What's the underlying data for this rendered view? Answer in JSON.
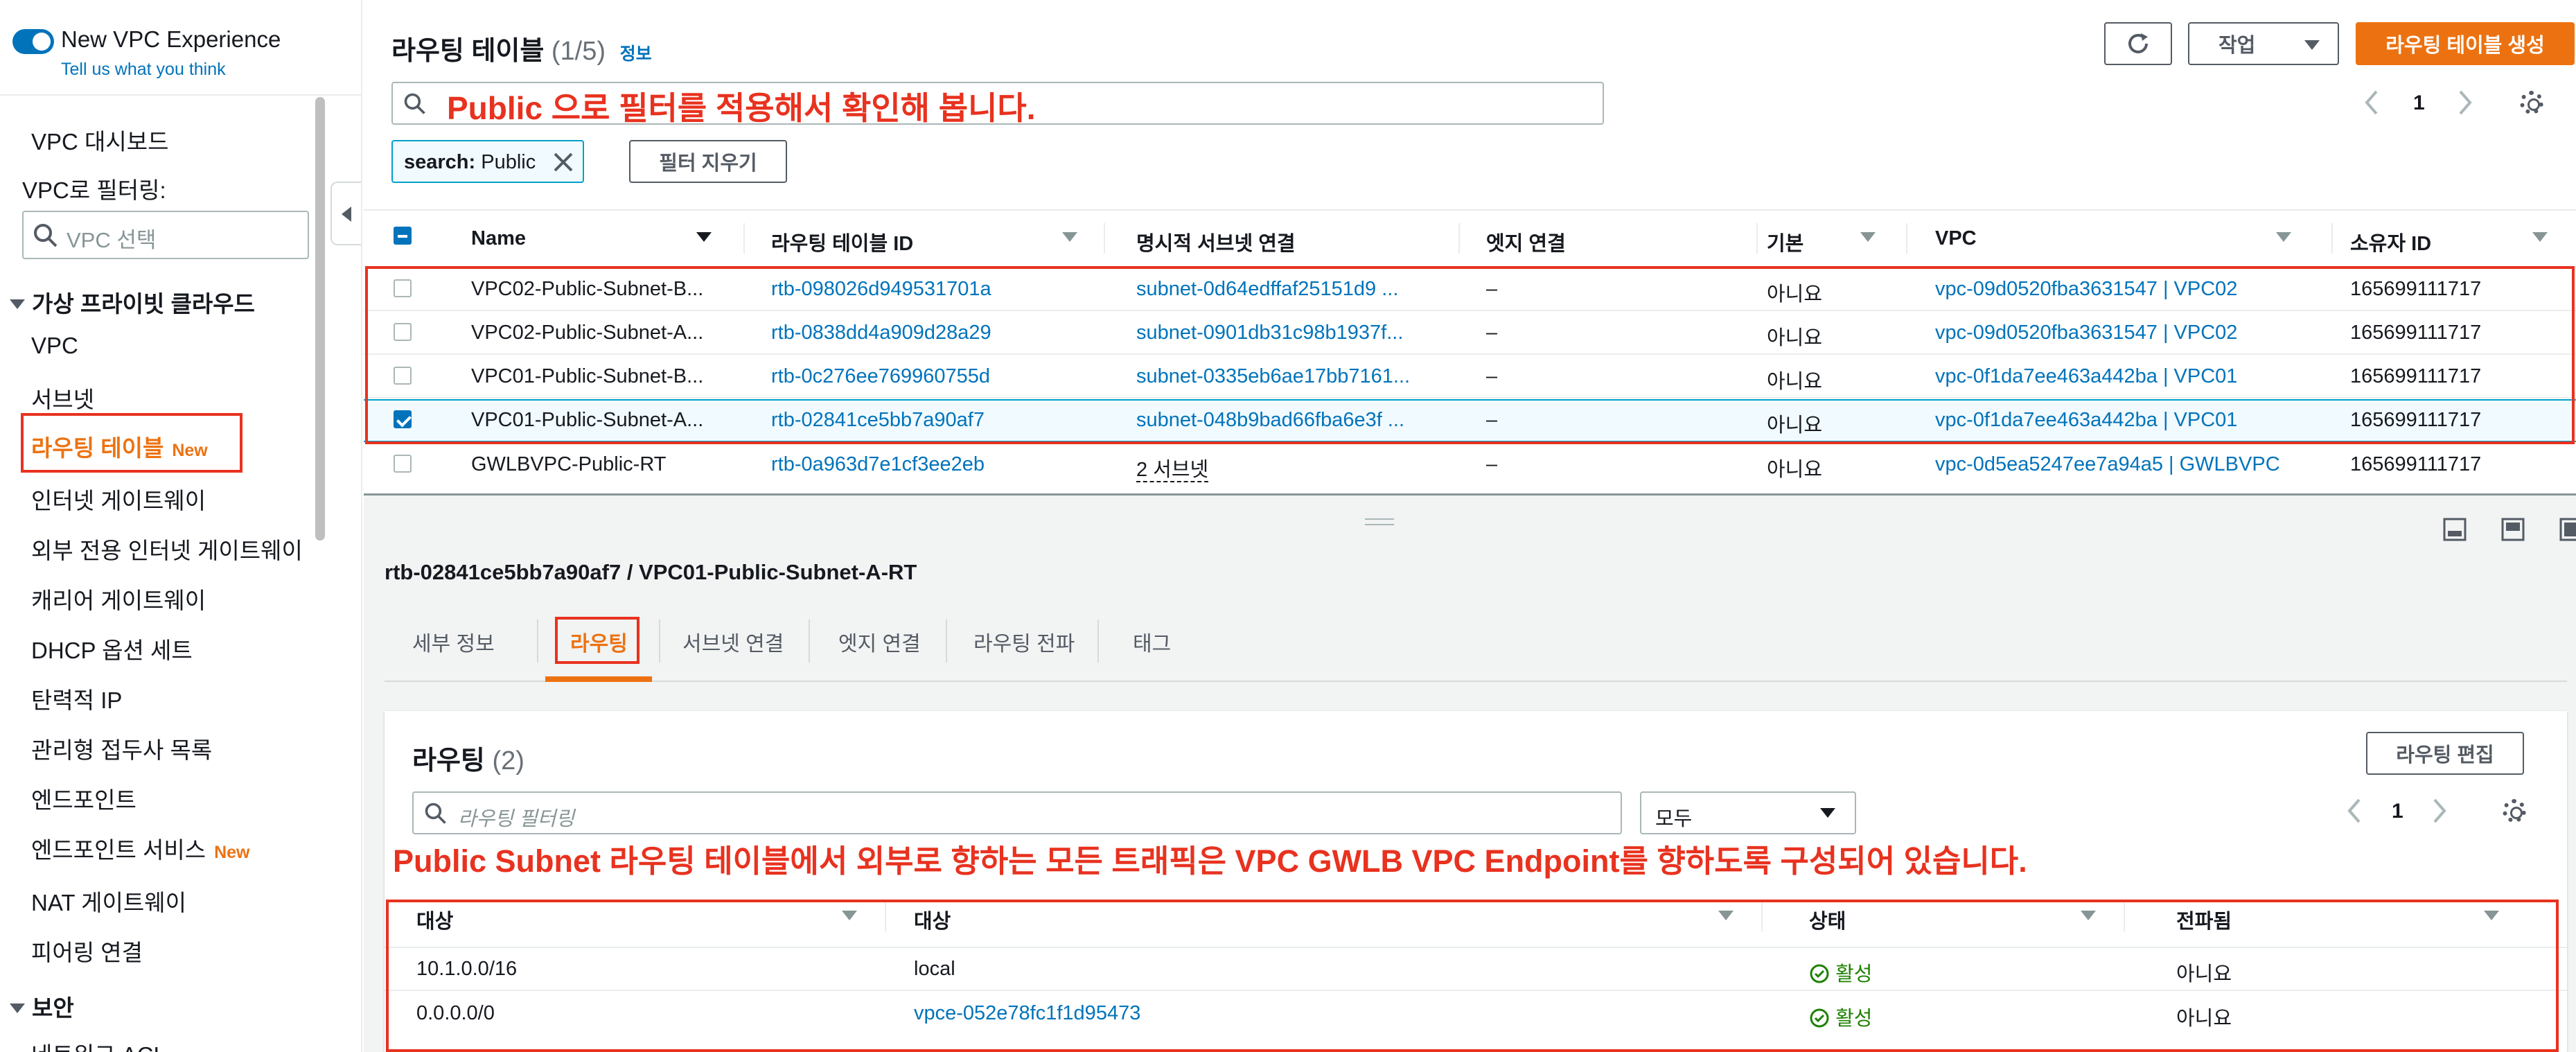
{
  "sidebar": {
    "experience_label": "New VPC Experience",
    "feedback_link": "Tell us what you think",
    "dashboard": "VPC 대시보드",
    "filter_label": "VPC로 필터링:",
    "filter_placeholder": "VPC 선택",
    "section_vpc": "가상 프라이빗 클라우드",
    "items": [
      {
        "label": "VPC"
      },
      {
        "label": "서브넷"
      },
      {
        "label": "라우팅 테이블",
        "badge": "New"
      },
      {
        "label": "인터넷 게이트웨이"
      },
      {
        "label": "외부 전용 인터넷 게이트웨이"
      },
      {
        "label": "캐리어 게이트웨이"
      },
      {
        "label": "DHCP 옵션 세트"
      },
      {
        "label": "탄력적 IP"
      },
      {
        "label": "관리형 접두사 목록"
      },
      {
        "label": "엔드포인트"
      },
      {
        "label": "엔드포인트 서비스",
        "badge": "New"
      },
      {
        "label": "NAT 게이트웨이"
      },
      {
        "label": "피어링 연결"
      }
    ],
    "section_security": "보안",
    "partial_item": "네트워크 ACL"
  },
  "header": {
    "title": "라우팅 테이블",
    "count": "(1/5)",
    "info": "정보",
    "actions_label": "작업",
    "create_label": "라우팅 테이블 생성"
  },
  "search": {
    "annotation": "Public 으로 필터를 적용해서 확인해 봅니다.",
    "token_key": "search:",
    "token_value": "Public",
    "clear_label": "필터 지우기",
    "page": "1"
  },
  "table": {
    "columns": [
      "Name",
      "라우팅 테이블 ID",
      "명시적 서브넷 연결",
      "엣지 연결",
      "기본",
      "VPC",
      "소유자 ID"
    ],
    "rows": [
      {
        "name": "VPC02-Public-Subnet-B...",
        "id": "rtb-098026d949531701a",
        "subnet": "subnet-0d64edffaf25151d9 ...",
        "edge": "–",
        "main": "아니요",
        "vpc": "vpc-09d0520fba3631547 | VPC02",
        "owner": "165699111717",
        "selected": false
      },
      {
        "name": "VPC02-Public-Subnet-A...",
        "id": "rtb-0838dd4a909d28a29",
        "subnet": "subnet-0901db31c98b1937f...",
        "edge": "–",
        "main": "아니요",
        "vpc": "vpc-09d0520fba3631547 | VPC02",
        "owner": "165699111717",
        "selected": false
      },
      {
        "name": "VPC01-Public-Subnet-B...",
        "id": "rtb-0c276ee769960755d",
        "subnet": "subnet-0335eb6ae17bb7161...",
        "edge": "–",
        "main": "아니요",
        "vpc": "vpc-0f1da7ee463a442ba | VPC01",
        "owner": "165699111717",
        "selected": false
      },
      {
        "name": "VPC01-Public-Subnet-A...",
        "id": "rtb-02841ce5bb7a90af7",
        "subnet": "subnet-048b9bad66fba6e3f ...",
        "edge": "–",
        "main": "아니요",
        "vpc": "vpc-0f1da7ee463a442ba | VPC01",
        "owner": "165699111717",
        "selected": true
      },
      {
        "name": "GWLBVPC-Public-RT",
        "id": "rtb-0a963d7e1cf3ee2eb",
        "subnet": "2 서브넷",
        "edge": "–",
        "main": "아니요",
        "vpc": "vpc-0d5ea5247ee7a94a5 | GWLBVPC",
        "owner": "165699111717",
        "selected": false
      }
    ]
  },
  "detail": {
    "title": "rtb-02841ce5bb7a90af7 / VPC01-Public-Subnet-A-RT",
    "tabs": [
      "세부 정보",
      "라우팅",
      "서브넷 연결",
      "엣지 연결",
      "라우팅 전파",
      "태그"
    ],
    "active_tab": "라우팅",
    "routes_title": "라우팅",
    "routes_count": "(2)",
    "edit_label": "라우팅 편집",
    "filter_placeholder": "라우팅 필터링",
    "select_value": "모두",
    "page": "1",
    "annotation": "Public Subnet 라우팅 테이블에서 외부로 향하는 모든 트래픽은 VPC GWLB VPC Endpoint를 향하도록 구성되어 있습니다.",
    "columns": [
      "대상",
      "대상",
      "상태",
      "전파됨"
    ],
    "routes": [
      {
        "destination": "10.1.0.0/16",
        "target": "local",
        "status": "활성",
        "propagated": "아니요"
      },
      {
        "destination": "0.0.0.0/0",
        "target": "vpce-052e78fc1f1d95473",
        "status": "활성",
        "propagated": "아니요"
      }
    ]
  },
  "colors": {
    "accent": "#ec7211",
    "link": "#0073bb",
    "annotation": "#e8321f",
    "active": "#1d8102"
  }
}
